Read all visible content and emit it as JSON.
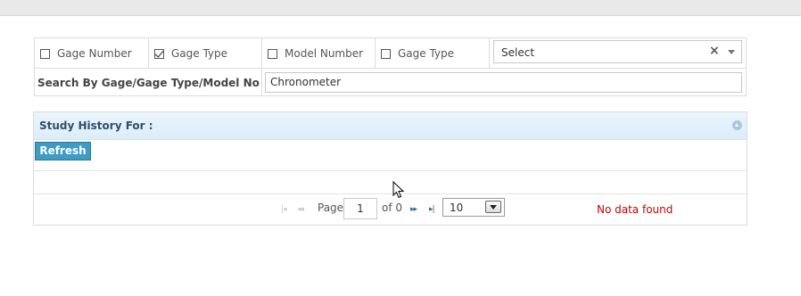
{
  "filters": {
    "options": [
      {
        "label": "Gage Number",
        "checked": false
      },
      {
        "label": "Gage Type",
        "checked": true
      },
      {
        "label": "Model Number",
        "checked": false
      },
      {
        "label": "Gage Type",
        "checked": false
      }
    ],
    "select": {
      "value": "Select",
      "clear_symbol": "×",
      "icon": "chevron-down-icon"
    },
    "search_label": "Search By Gage/Gage Type/Model No",
    "search_value": "Chronometer"
  },
  "grid": {
    "title": "Study History For :",
    "collapse_icon": "collapse-up-icon",
    "refresh_label": "Refresh",
    "pager": {
      "first_icon": "|◂",
      "prev_icon": "◂◂",
      "page_label": "Page",
      "current_page": "1",
      "of_label": "of 0",
      "next_icon": "▸▸",
      "last_icon": "▸|",
      "page_size": "10",
      "empty_message": "No data found"
    }
  },
  "colors": {
    "header_bg": "#dcedf8",
    "header_text": "#2e4f6e",
    "button_bg": "#3e9bc4",
    "error_text": "#cc0000"
  }
}
